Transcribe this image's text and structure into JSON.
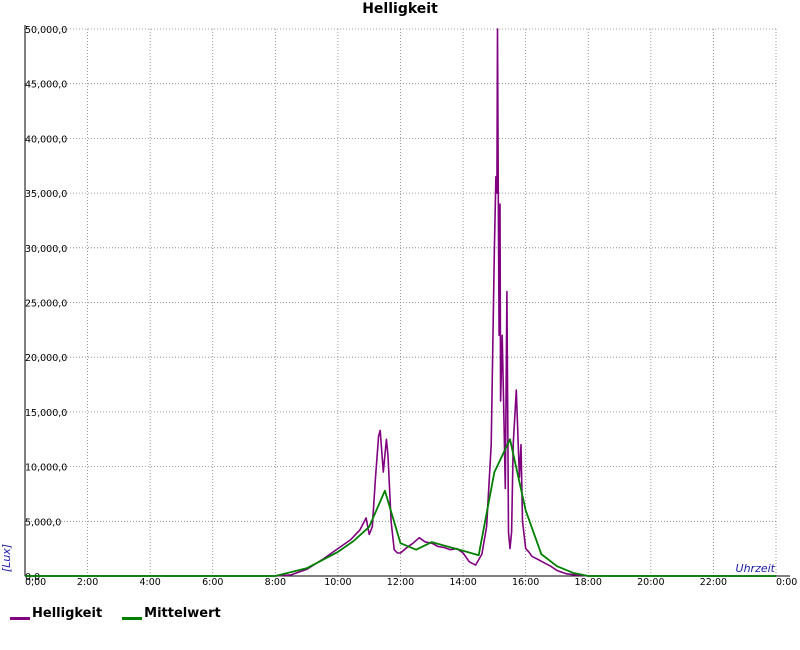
{
  "chart_data": {
    "type": "line",
    "title": "Helligkeit",
    "xlabel": "Uhrzeit",
    "ylabel": "[Lux]",
    "xlim": [
      0,
      24
    ],
    "ylim": [
      0,
      50000
    ],
    "xtick_labels": [
      "0,00",
      "2:00",
      "4:00",
      "6:00",
      "8:00",
      "10:00",
      "12:00",
      "14:00",
      "16:00",
      "18:00",
      "20:00",
      "22:00",
      "0:00"
    ],
    "ytick_labels": [
      "0,0",
      "5,000,0",
      "10,000,0",
      "15,000,0",
      "20,000,0",
      "25,000,0",
      "30,000,0",
      "35,000,0",
      "40,000,0",
      "45,000,0",
      "50,000,0"
    ],
    "grid": true,
    "legend_position": "bottom-left",
    "series": [
      {
        "name": "Helligkeit",
        "color": "#800080",
        "x": [
          0,
          8.0,
          8.5,
          9.0,
          9.5,
          10.0,
          10.4,
          10.7,
          10.9,
          11.0,
          11.1,
          11.2,
          11.3,
          11.35,
          11.45,
          11.55,
          11.6,
          11.7,
          11.8,
          11.9,
          12.0,
          12.2,
          12.4,
          12.6,
          12.8,
          13.0,
          13.2,
          13.4,
          13.6,
          13.8,
          14.0,
          14.2,
          14.4,
          14.6,
          14.75,
          14.9,
          14.95,
          15.0,
          15.05,
          15.08,
          15.1,
          15.13,
          15.15,
          15.18,
          15.2,
          15.25,
          15.3,
          15.35,
          15.4,
          15.45,
          15.5,
          15.55,
          15.6,
          15.7,
          15.8,
          15.85,
          15.9,
          16.0,
          16.1,
          16.2,
          16.4,
          16.6,
          16.8,
          17.0,
          17.3,
          17.6,
          18.0,
          24
        ],
        "y": [
          0,
          0,
          100,
          600,
          1500,
          2500,
          3300,
          4200,
          5300,
          3800,
          4500,
          9000,
          12800,
          13300,
          9500,
          12500,
          11000,
          5000,
          2400,
          2100,
          2100,
          2600,
          3000,
          3500,
          3100,
          3000,
          2700,
          2600,
          2400,
          2500,
          2100,
          1300,
          1000,
          2000,
          4500,
          12000,
          21000,
          30000,
          36500,
          35000,
          50000,
          33000,
          22000,
          34000,
          16000,
          22000,
          15000,
          8000,
          26000,
          4000,
          2500,
          4000,
          12000,
          17000,
          9000,
          12000,
          5000,
          2500,
          2200,
          1800,
          1500,
          1200,
          900,
          500,
          200,
          100,
          0,
          0
        ]
      },
      {
        "name": "Mittelwert",
        "color": "#008000",
        "x": [
          0,
          8.0,
          9.0,
          10.0,
          10.5,
          11.0,
          11.5,
          12.0,
          12.5,
          13.0,
          13.5,
          14.0,
          14.5,
          15.0,
          15.5,
          16.0,
          16.5,
          17.0,
          17.5,
          18.0,
          24
        ],
        "y": [
          0,
          0,
          700,
          2200,
          3200,
          4500,
          7800,
          3000,
          2400,
          3100,
          2700,
          2300,
          1900,
          9500,
          12500,
          6000,
          2000,
          900,
          300,
          0,
          0
        ]
      }
    ]
  }
}
